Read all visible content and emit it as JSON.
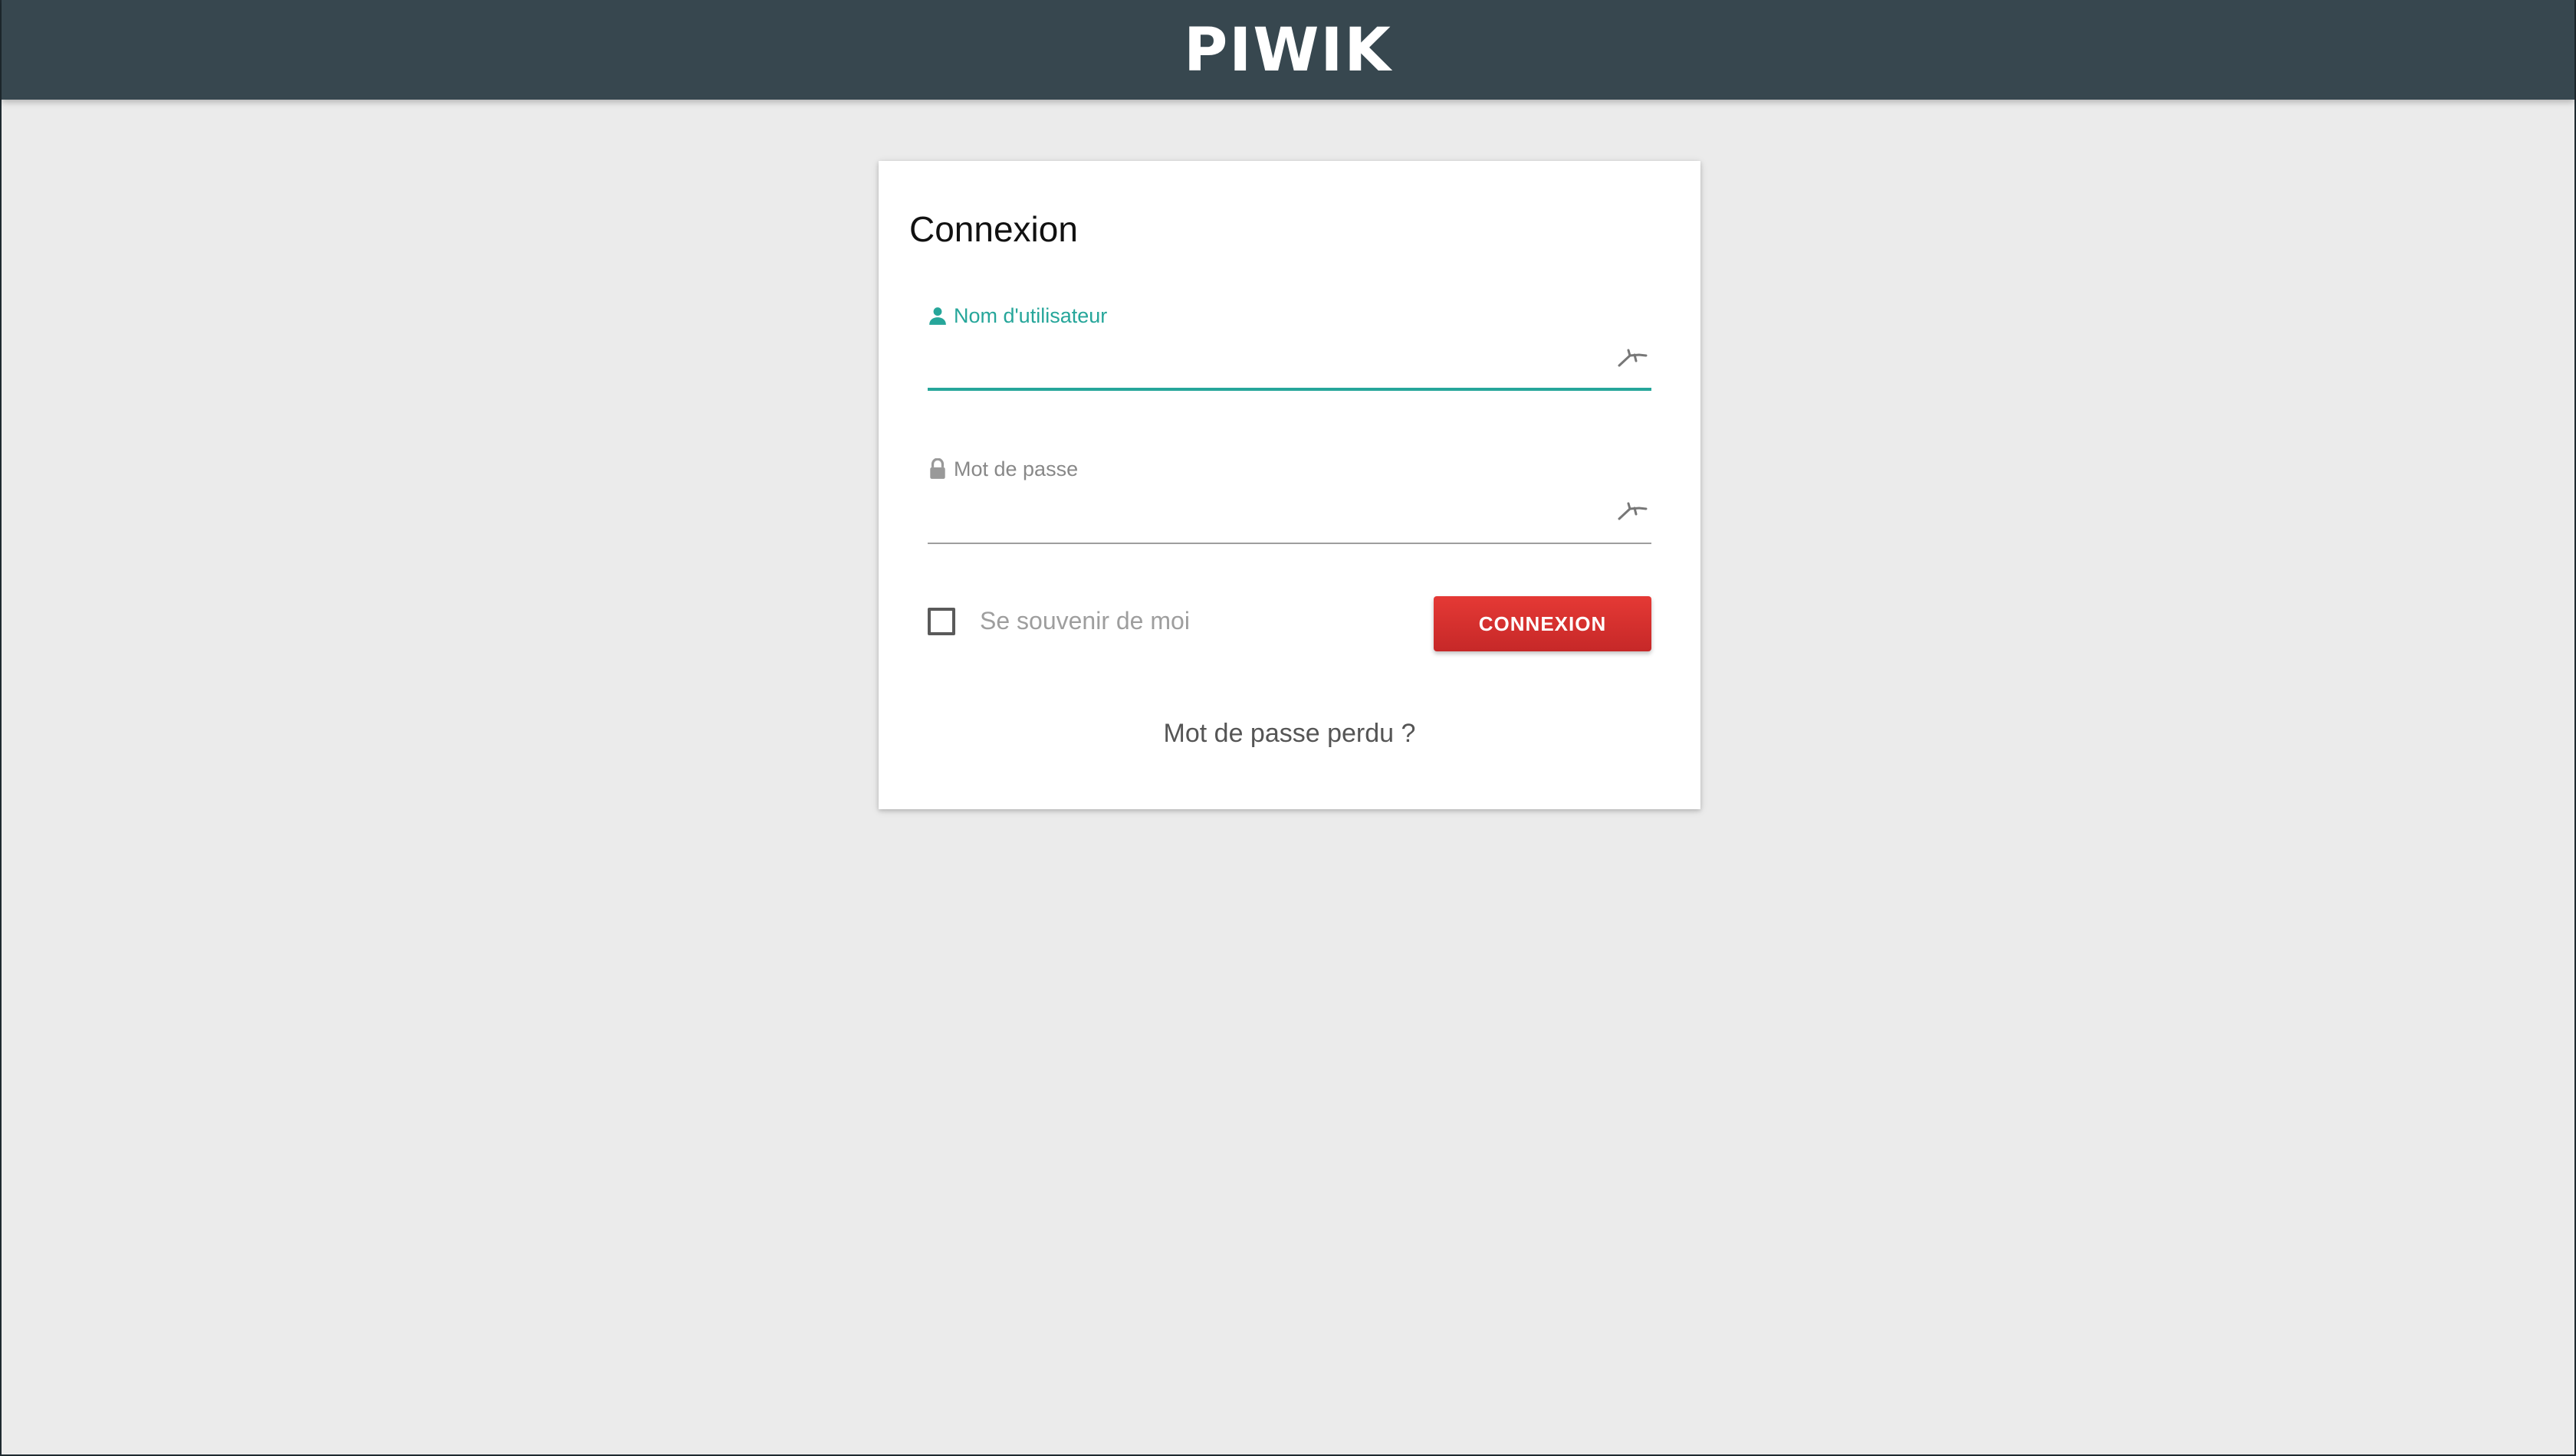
{
  "brand": {
    "logo_text": "PIWIK"
  },
  "login": {
    "title": "Connexion",
    "username": {
      "label": "Nom d'utilisateur",
      "value": "",
      "icon": "user-icon"
    },
    "password": {
      "label": "Mot de passe",
      "value": "",
      "icon": "lock-icon"
    },
    "remember_me": {
      "label": "Se souvenir de moi",
      "checked": false
    },
    "submit_label": "CONNEXION",
    "lost_password_link": "Mot de passe perdu ?"
  },
  "colors": {
    "header_bg": "#37474f",
    "accent_teal": "#26a69a",
    "button_red": "#d32f2f",
    "page_bg": "#ebebeb"
  }
}
